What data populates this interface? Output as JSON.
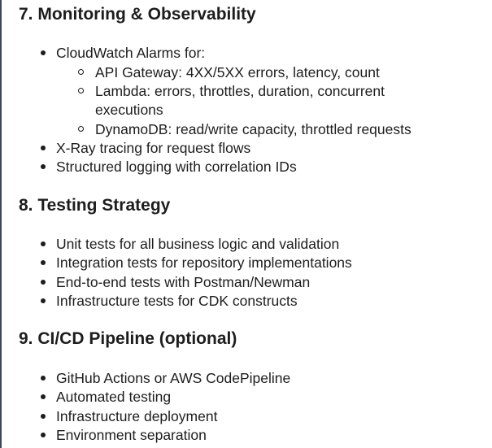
{
  "sections": [
    {
      "heading": "7. Monitoring & Observability",
      "alarms_intro": "CloudWatch Alarms for:",
      "alarm_items": [
        "API Gateway: 4XX/5XX errors, latency, count",
        "Lambda: errors, throttles, duration, concurrent",
        "executions",
        "DynamoDB: read/write capacity, throttled requests"
      ],
      "items": [
        "X-Ray tracing for request flows",
        "Structured logging with correlation IDs"
      ]
    },
    {
      "heading": "8. Testing Strategy",
      "items": [
        "Unit tests for all business logic and validation",
        "Integration tests for repository implementations",
        "End-to-end tests with Postman/Newman",
        "Infrastructure tests for CDK constructs"
      ]
    },
    {
      "heading": "9. CI/CD Pipeline (optional)",
      "items": [
        "GitHub Actions or AWS CodePipeline",
        "Automated testing",
        "Infrastructure deployment",
        "Environment separation"
      ]
    }
  ]
}
